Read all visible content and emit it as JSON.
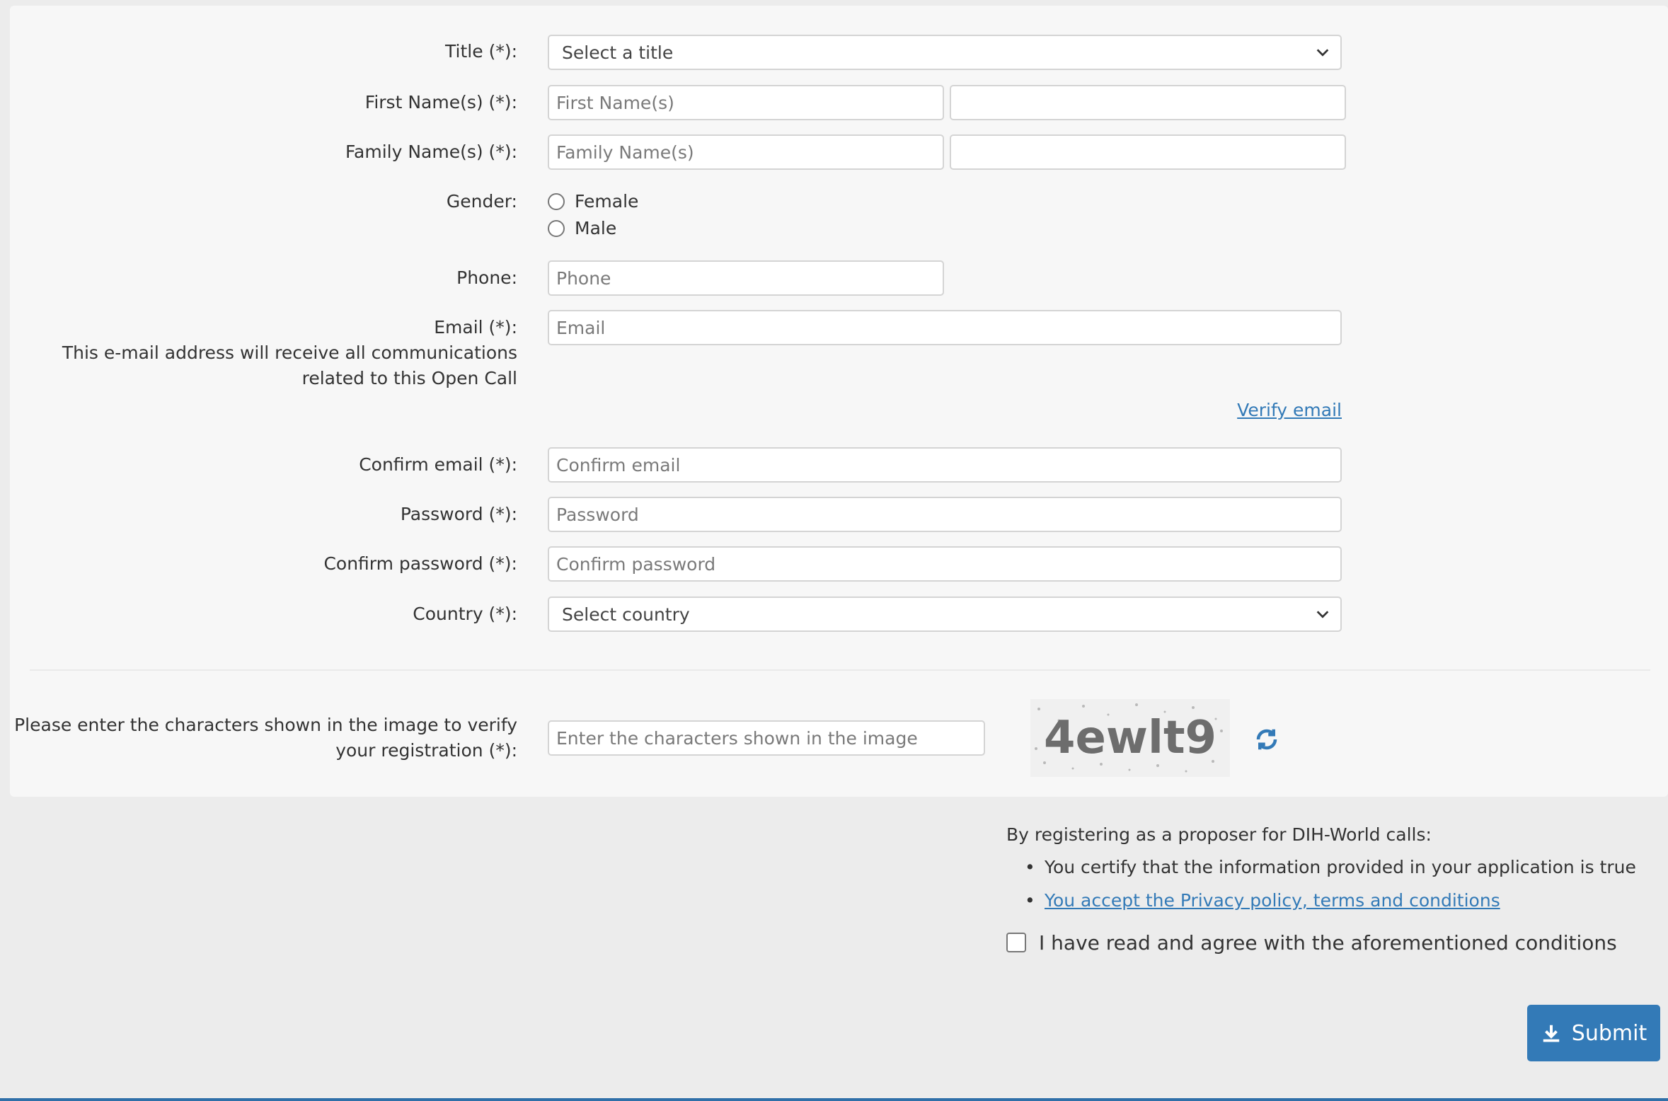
{
  "form": {
    "title": {
      "label": "Title (*):",
      "value": "Select a title"
    },
    "first_name": {
      "label": "First Name(s) (*):",
      "placeholder": "First Name(s)"
    },
    "family_name": {
      "label": "Family Name(s) (*):",
      "placeholder": "Family Name(s)"
    },
    "gender": {
      "label": "Gender:",
      "options": [
        "Female",
        "Male"
      ]
    },
    "phone": {
      "label": "Phone:",
      "placeholder": "Phone"
    },
    "email": {
      "label": "Email (*):",
      "note": "This e-mail address will receive all communications related to this Open Call",
      "placeholder": "Email",
      "verify_link": "Verify email"
    },
    "confirm_email": {
      "label": "Confirm email (*):",
      "placeholder": "Confirm email"
    },
    "password": {
      "label": "Password (*):",
      "placeholder": "Password"
    },
    "confirm_password": {
      "label": "Confirm password (*):",
      "placeholder": "Confirm password"
    },
    "country": {
      "label": "Country (*):",
      "value": "Select country"
    },
    "captcha": {
      "label": "Please enter the characters shown in the image to verify your registration (*):",
      "placeholder": "Enter the characters shown in the image",
      "image_text": "4ewlt9",
      "refresh_icon": "refresh-icon"
    }
  },
  "conditions": {
    "intro": "By registering as a proposer for DIH-World calls:",
    "items": [
      "You certify that the information provided in your application is true",
      "You accept the Privacy policy, terms and conditions"
    ],
    "agree_label": "I have read and agree with the aforementioned conditions"
  },
  "submit": {
    "label": "Submit",
    "icon": "download-icon"
  },
  "colors": {
    "accent": "#337ab7",
    "page_bg": "#ececec",
    "panel_bg": "#f7f7f7"
  }
}
